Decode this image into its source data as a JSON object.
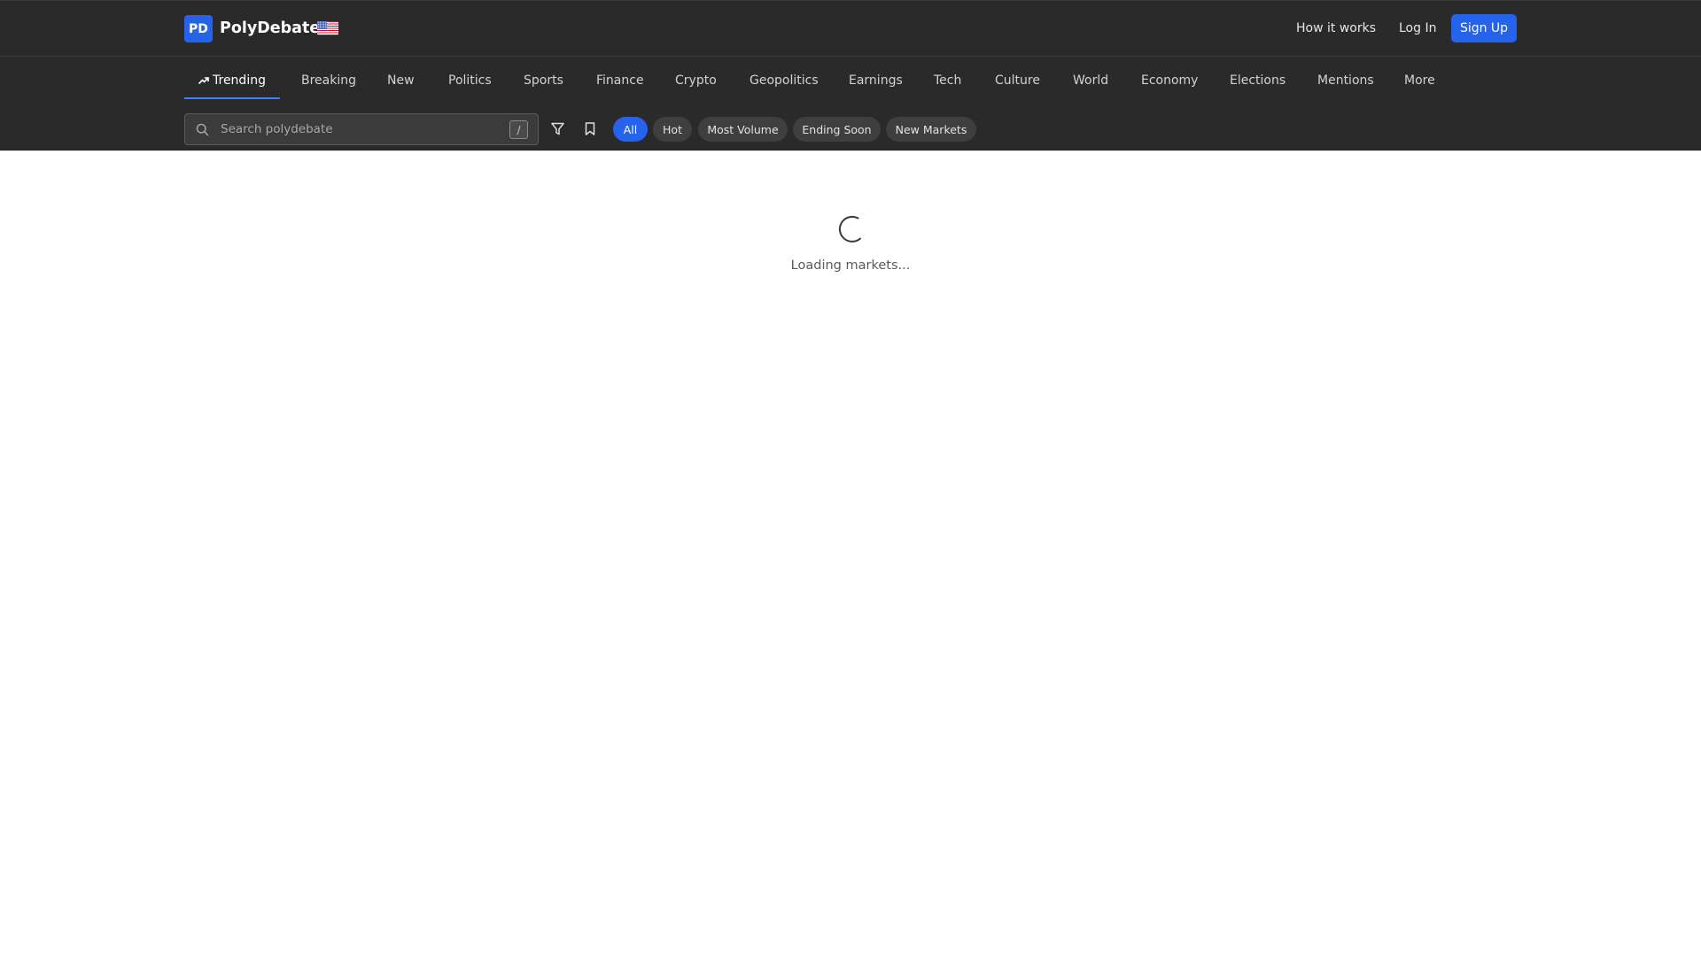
{
  "brand": {
    "logo_initials": "PD",
    "name": "PolyDebate",
    "flag": "us-flag",
    "accent_color": "#2563eb"
  },
  "topbar": {
    "how_it_works": "How it works",
    "login": "Log In",
    "signup": "Sign Up"
  },
  "nav": {
    "items": [
      {
        "label": "Trending",
        "icon": "trending-up-icon",
        "active": true
      },
      {
        "label": "Breaking"
      },
      {
        "label": "New"
      },
      {
        "label": "Politics"
      },
      {
        "label": "Sports"
      },
      {
        "label": "Finance"
      },
      {
        "label": "Crypto"
      },
      {
        "label": "Geopolitics"
      },
      {
        "label": "Earnings"
      },
      {
        "label": "Tech"
      },
      {
        "label": "Culture"
      },
      {
        "label": "World"
      },
      {
        "label": "Economy"
      },
      {
        "label": "Elections"
      },
      {
        "label": "Mentions"
      },
      {
        "label": "More"
      }
    ]
  },
  "search": {
    "placeholder": "Search polydebate",
    "value": "",
    "shortcut_key": "/"
  },
  "tools": {
    "filter_icon": "filter-icon",
    "bookmark_icon": "bookmark-icon"
  },
  "filters": {
    "chips": [
      {
        "label": "All",
        "active": true
      },
      {
        "label": "Hot"
      },
      {
        "label": "Most Volume"
      },
      {
        "label": "Ending Soon"
      },
      {
        "label": "New Markets"
      }
    ]
  },
  "main": {
    "loading_text": "Loading markets..."
  }
}
